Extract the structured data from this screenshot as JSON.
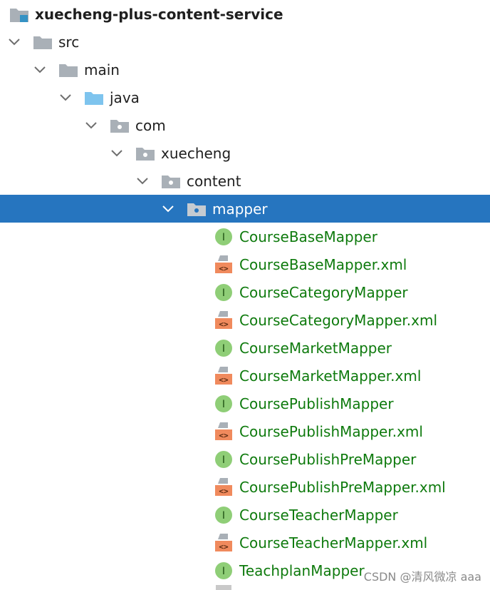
{
  "tree": {
    "project": {
      "label": "xuecheng-plus-content-service",
      "icon": "module-folder-icon"
    },
    "folders": [
      {
        "key": "src",
        "label": "src",
        "icon": "folder-icon"
      },
      {
        "key": "main",
        "label": "main",
        "icon": "folder-icon"
      },
      {
        "key": "java",
        "label": "java",
        "icon": "source-root-folder-icon"
      },
      {
        "key": "com",
        "label": "com",
        "icon": "package-icon"
      },
      {
        "key": "xuecheng",
        "label": "xuecheng",
        "icon": "package-icon"
      },
      {
        "key": "content",
        "label": "content",
        "icon": "package-icon"
      },
      {
        "key": "mapper",
        "label": "mapper",
        "icon": "package-icon",
        "selected": true
      }
    ],
    "files": [
      {
        "label": "CourseBaseMapper",
        "type": "interface"
      },
      {
        "label": "CourseBaseMapper.xml",
        "type": "xml"
      },
      {
        "label": "CourseCategoryMapper",
        "type": "interface"
      },
      {
        "label": "CourseCategoryMapper.xml",
        "type": "xml"
      },
      {
        "label": "CourseMarketMapper",
        "type": "interface"
      },
      {
        "label": "CourseMarketMapper.xml",
        "type": "xml"
      },
      {
        "label": "CoursePublishMapper",
        "type": "interface"
      },
      {
        "label": "CoursePublishMapper.xml",
        "type": "xml"
      },
      {
        "label": "CoursePublishPreMapper",
        "type": "interface"
      },
      {
        "label": "CoursePublishPreMapper.xml",
        "type": "xml"
      },
      {
        "label": "CourseTeacherMapper",
        "type": "interface"
      },
      {
        "label": "CourseTeacherMapper.xml",
        "type": "xml"
      },
      {
        "label": "TeachplanMapper",
        "type": "interface"
      }
    ]
  },
  "interface_badge": "I",
  "xml_badge": "<>",
  "watermark": "CSDN @清风微凉 aaa",
  "colors": {
    "selection": "#2675bf",
    "file_text": "#0e7a0d",
    "interface_badge": "#8fce77",
    "xml_badge": "#f08a5d",
    "folder": "#a9b0b7",
    "source_root": "#7ec4ee"
  }
}
